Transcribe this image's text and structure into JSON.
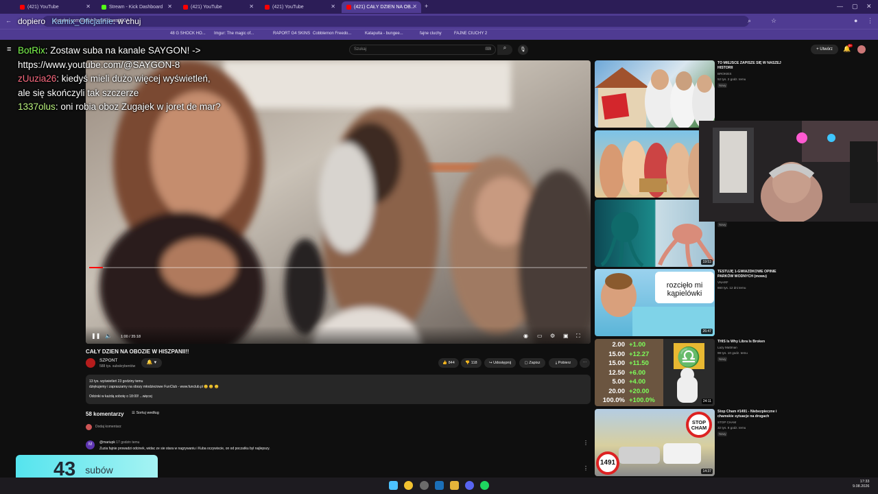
{
  "browser": {
    "tabs": [
      {
        "label": "(421) YouTube",
        "active": false
      },
      {
        "label": "Stream - Kick Dashboard",
        "active": false
      },
      {
        "label": "(421) YouTube",
        "active": false
      },
      {
        "label": "(421) YouTube",
        "active": false
      },
      {
        "label": "(421) CAŁY DZIEN NA OB...",
        "active": true
      }
    ],
    "url": "youtube.com/watch?v=3Fduwstt90A",
    "bookmarks": [
      "48 G SHOCK HO...",
      "Imgur: The magic of...",
      "RAPORT G4 SKINS",
      "Cobblemon Freedo...",
      "Katapulta - bungee...",
      "fajne cluchy",
      "FAJNE CIUCHY 2"
    ]
  },
  "overlay": {
    "top_line": {
      "user": "dopiero",
      "chat_user": "Kamix_Oficjalnie",
      "chat_text": ": w chuj"
    },
    "messages": [
      {
        "user": "BotRix",
        "color": "#7fff4f",
        "text": ": Zostaw suba na kanale SAYGON! -> https://www.youtube.com/@SAYGON-8"
      },
      {
        "user": "zUuzia26",
        "color": "#ff6b81",
        "text": ": kiedyś mieli dużo więcej wyświetleń, ale się skończyli tak szczerze"
      },
      {
        "user": "1337olus",
        "color": "#b9f27c",
        "text": ": oni robia oboz Zugajek w joret de mar?"
      }
    ],
    "subs_count": "43",
    "subs_label": "subów"
  },
  "youtube": {
    "search_placeholder": "Szukaj",
    "create_label": "+ Utwórz",
    "notif_badge": "9+",
    "player": {
      "time": "1:00 / 35:18",
      "progress": 0.028
    },
    "video_title": "CAŁY DZIEN NA OBOZIE W HISZPANII!!",
    "channel": {
      "name": "SZPONT",
      "subs": "588 tys. subskrybentów"
    },
    "actions": {
      "likes": "844",
      "dislikes": "118",
      "share": "Udostępnij",
      "save": "Zapisz",
      "download": "Pobierz"
    },
    "description": {
      "stats": "13 tys. wyświetleń  23 godziny temu",
      "line1": "dziękujemy i zapraszamy na obozy młodzieżowe FunClub - www.funclub.pl 😊 😊 😊",
      "line2": "Odcinki w każdą sobotę o 18:00! ...więcej"
    },
    "comments": {
      "count": "58 komentarzy",
      "sort": "Sortuj według",
      "add": "Dodaj komentarz",
      "items": [
        {
          "avatar": "M",
          "user": "@mariupk",
          "time": "17 godzin temu",
          "text": "Zuzia fajnie prowadzi odcinek, widac ze sie stara w nagrywaniu i Kuba oczywiscie, on od poczatku byl najlepszy."
        }
      ]
    },
    "related": [
      {
        "title": "TO MIEJSCE ZAPISZE SIĘ W NASZEJ HISTORII",
        "channel": "BROKIES",
        "meta": "52 tys.  2 godz. temu",
        "badge": "Nowy",
        "duration": ""
      },
      {
        "title": "",
        "channel": "",
        "meta": "",
        "badge": "Nowy",
        "duration": ""
      },
      {
        "title": "",
        "channel": "",
        "meta": "",
        "badge": "",
        "duration": "19:53"
      },
      {
        "title": "TESTUJĘ 1-GWIAZDKOWE OPINIE PARKÓW WODNYCH (mowu)",
        "channel": "VNARF",
        "meta": "660 tys.  12 dni temu",
        "badge": "",
        "duration": "26:47",
        "overlay": "rozcięło mi kąpielówki"
      },
      {
        "title": "THIS Is Why Libra Is Broken",
        "channel": "Lazy Mattman",
        "meta": "98 tys.  10 godz. temu",
        "badge": "Nowy",
        "duration": "24:11"
      },
      {
        "title": "Stop Cham #1491 - Niebezpieczne i chamskie sytuacje na drogach",
        "channel": "STOP CHAM",
        "meta": "32 tys.  8 godz. temu",
        "badge": "Nowy",
        "duration": "14:37",
        "sign": "STOP CHAM",
        "number": "1491"
      }
    ],
    "stats_table": [
      [
        "2.00",
        "+1.00"
      ],
      [
        "15.00",
        "+12.27"
      ],
      [
        "15.00",
        "+11.50"
      ],
      [
        "12.50",
        "+6.00"
      ],
      [
        "5.00",
        "+4.00"
      ],
      [
        "20.00",
        "+20.00"
      ],
      [
        "100.0%",
        "+100.0%"
      ]
    ]
  },
  "taskbar": {
    "time": "17:33",
    "date": "9.08.2026"
  }
}
